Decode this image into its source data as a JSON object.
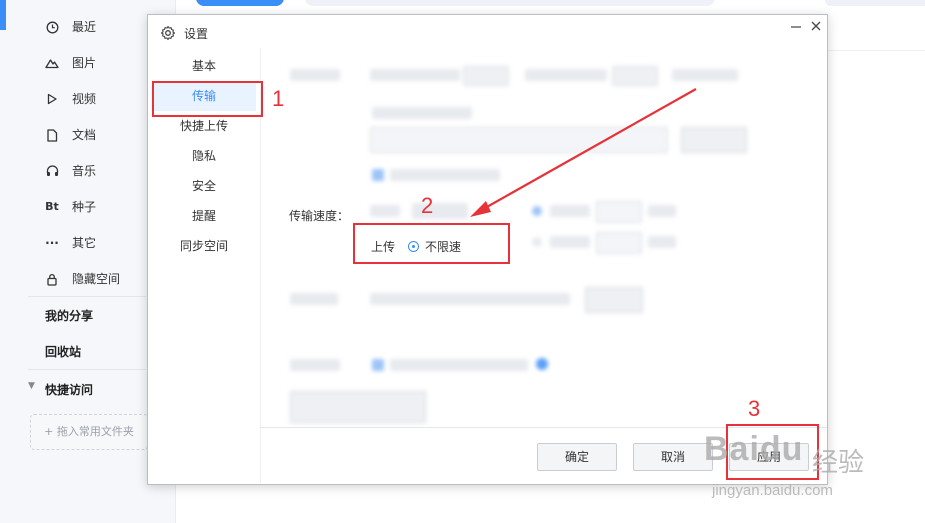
{
  "sidebar": {
    "items": [
      {
        "icon": "clock-icon",
        "label": "最近"
      },
      {
        "icon": "mountain-icon",
        "label": "图片"
      },
      {
        "icon": "play-icon",
        "label": "视频"
      },
      {
        "icon": "document-icon",
        "label": "文档"
      },
      {
        "icon": "headphones-icon",
        "label": "音乐"
      },
      {
        "icon": "bt-icon",
        "label": "种子"
      },
      {
        "icon": "more-icon",
        "label": "其它"
      },
      {
        "icon": "lock-icon",
        "label": "隐藏空间"
      }
    ],
    "my_share": "我的分享",
    "recycle": "回收站",
    "quick_access": "快捷访问",
    "quick_drop": "+ 拖入常用文件夹",
    "bt_glyph": "Bt",
    "more_glyph": "···"
  },
  "dialog": {
    "title": "设置",
    "nav": [
      "基本",
      "传输",
      "快捷上传",
      "隐私",
      "安全",
      "提醒",
      "同步空间"
    ],
    "active_nav": "传输",
    "speed_label": "传输速度：",
    "upload_label": "上传",
    "upload_option": "不限速",
    "buttons": {
      "ok": "确定",
      "cancel": "取消",
      "apply": "应用"
    }
  },
  "annotations": {
    "n1": "1",
    "n2": "2",
    "n3": "3"
  },
  "watermark": {
    "brand": "Baidu",
    "cn": "经验",
    "url": "jingyan.baidu.com"
  },
  "colors": {
    "accent": "#3a8ef6",
    "annotation": "#e63238"
  }
}
